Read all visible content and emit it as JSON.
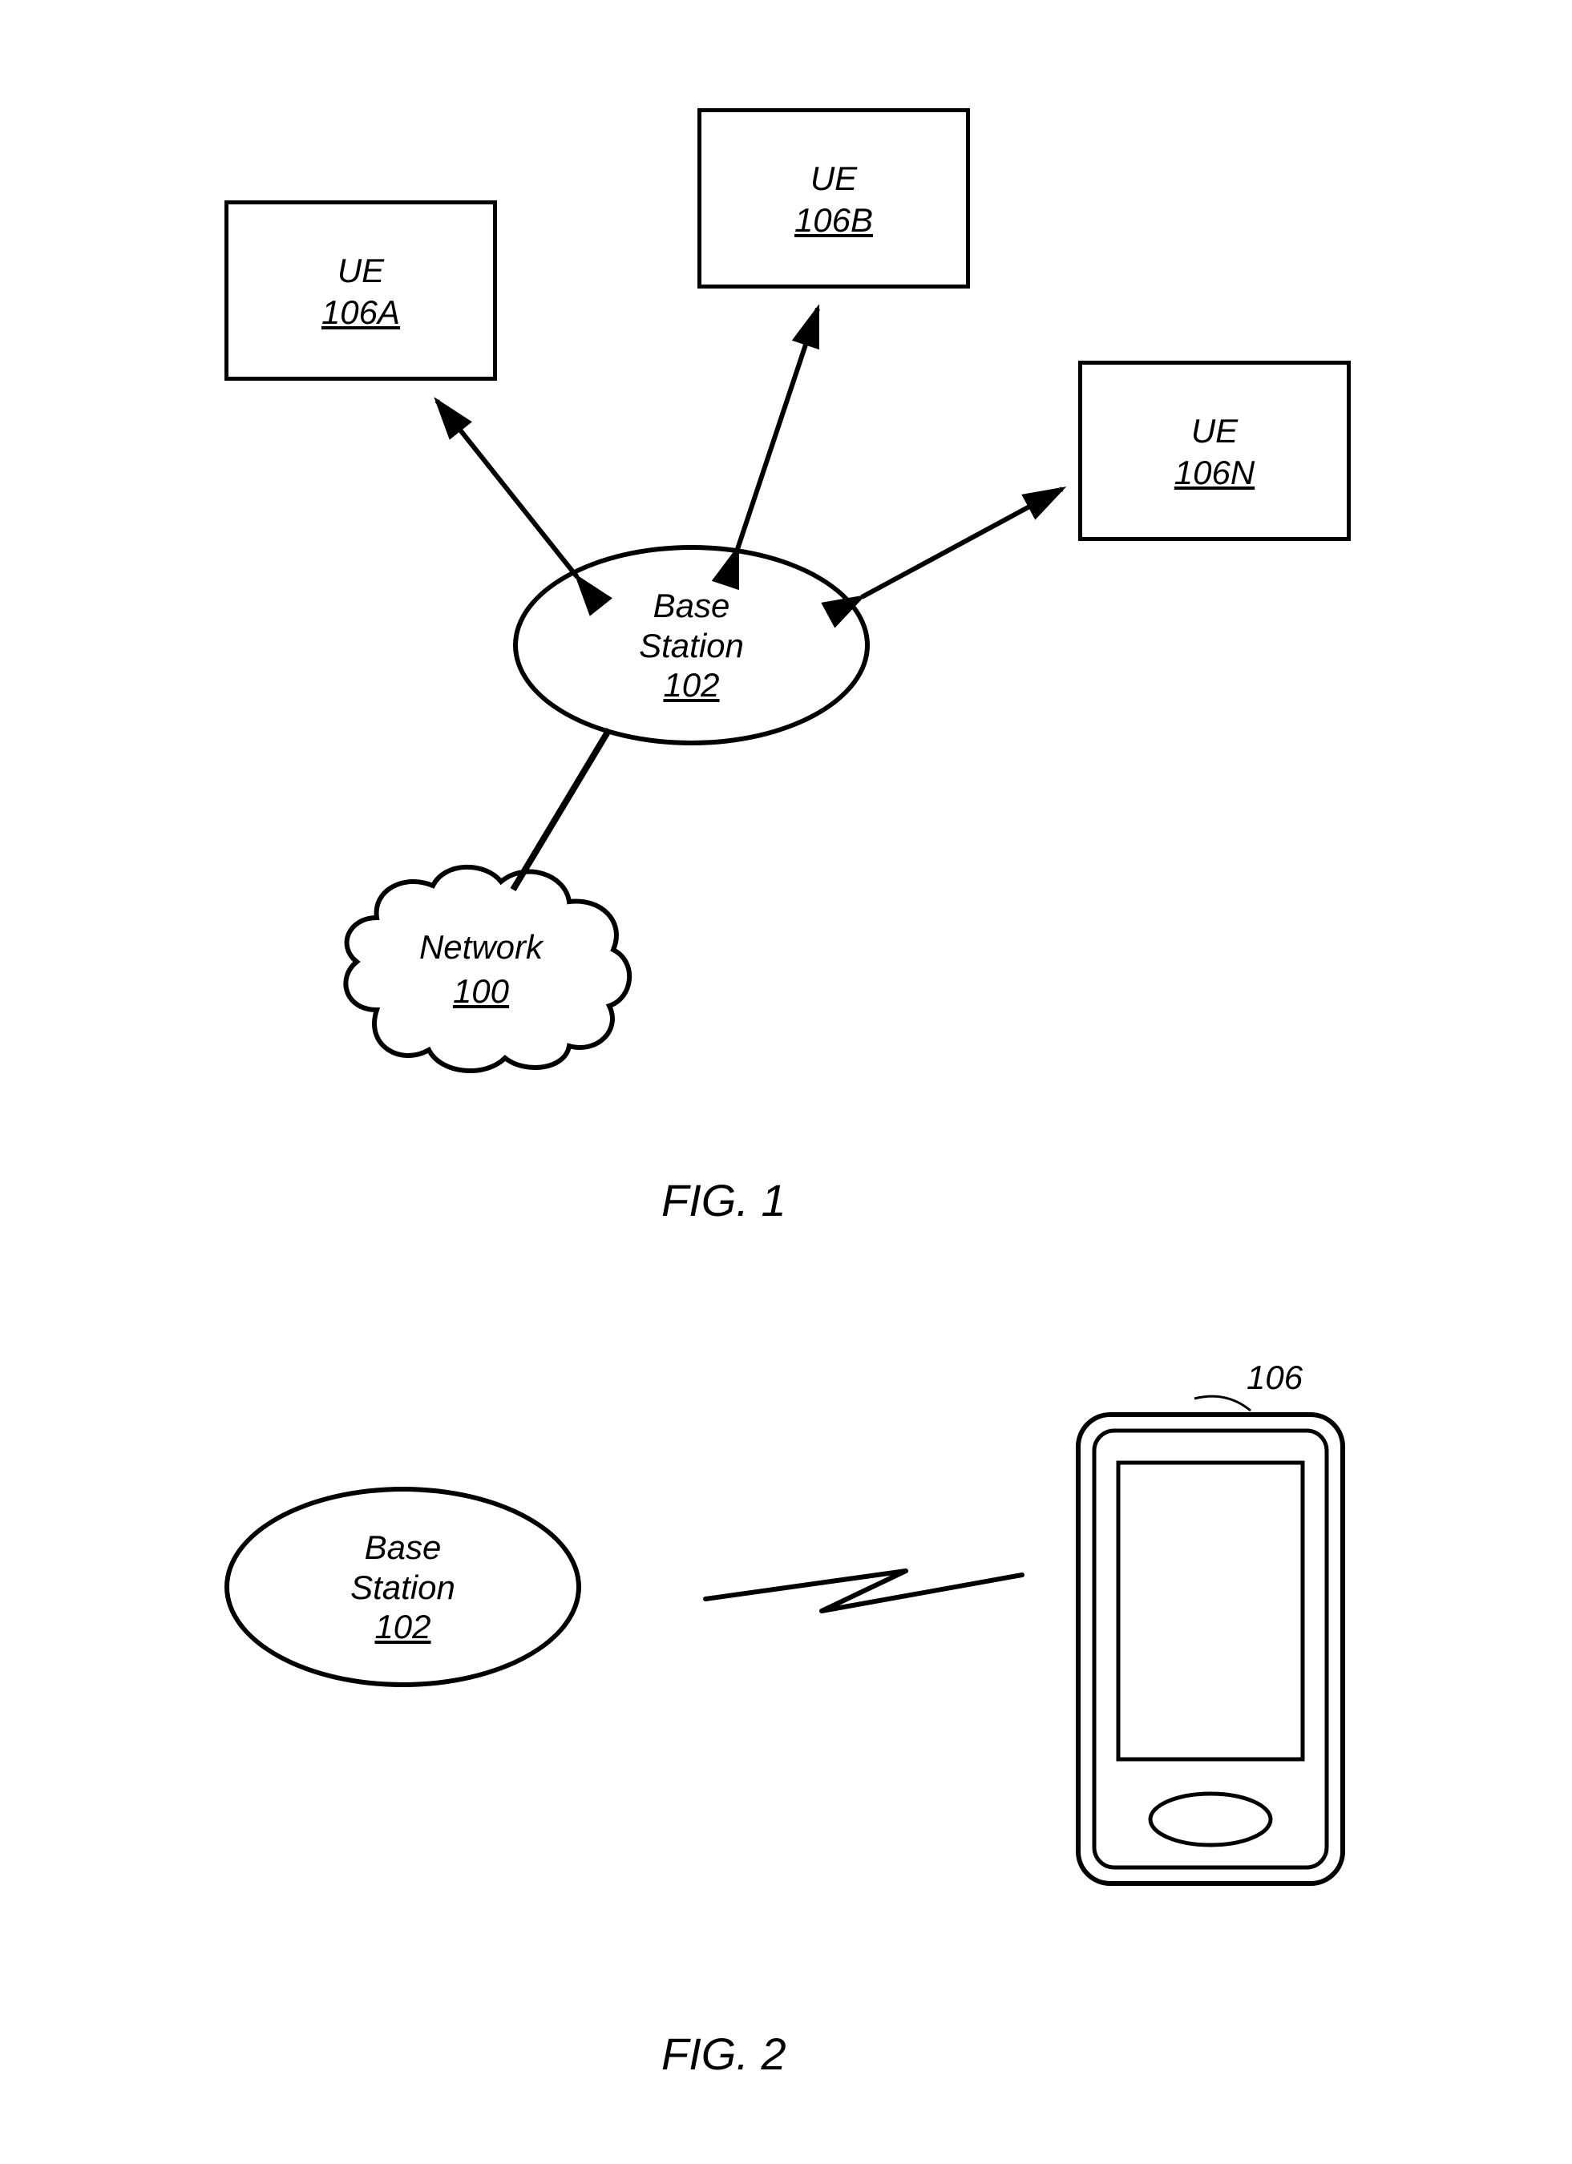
{
  "fig1": {
    "ue_a": {
      "label": "UE",
      "ref": "106A"
    },
    "ue_b": {
      "label": "UE",
      "ref": "106B"
    },
    "ue_n": {
      "label": "UE",
      "ref": "106N"
    },
    "base_station": {
      "label1": "Base",
      "label2": "Station",
      "ref": "102"
    },
    "network": {
      "label": "Network",
      "ref": "100"
    },
    "caption": "FIG. 1"
  },
  "fig2": {
    "base_station": {
      "label1": "Base",
      "label2": "Station",
      "ref": "102"
    },
    "phone_ref": "106",
    "caption": "FIG. 2"
  }
}
